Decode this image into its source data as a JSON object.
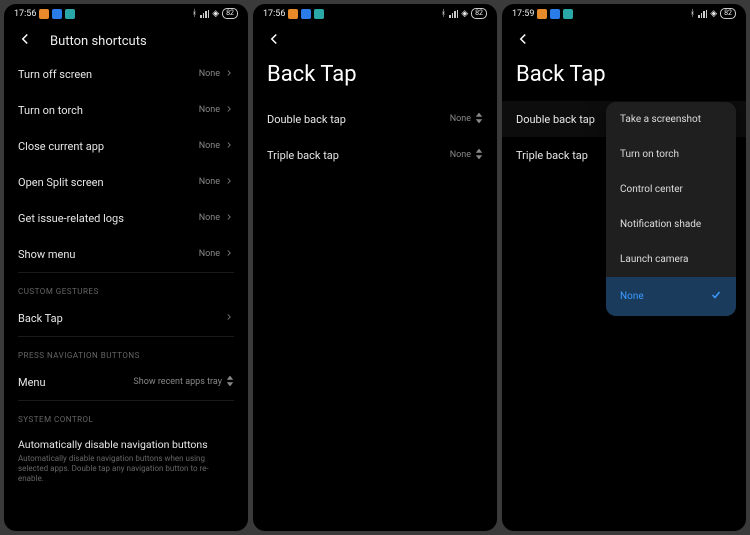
{
  "screen1": {
    "status": {
      "time": "17:56",
      "battery": "82"
    },
    "title": "Button shortcuts",
    "rows": [
      {
        "label": "Turn off screen",
        "value": "None"
      },
      {
        "label": "Turn on torch",
        "value": "None"
      },
      {
        "label": "Close current app",
        "value": "None"
      },
      {
        "label": "Open Split screen",
        "value": "None"
      },
      {
        "label": "Get issue-related logs",
        "value": "None"
      },
      {
        "label": "Show menu",
        "value": "None"
      }
    ],
    "section_custom": "CUSTOM GESTURES",
    "backtap_label": "Back Tap",
    "section_nav": "PRESS NAVIGATION BUTTONS",
    "menu_label": "Menu",
    "menu_value": "Show recent apps tray",
    "section_system": "SYSTEM CONTROL",
    "auto_disable_title": "Automatically disable navigation buttons",
    "auto_disable_sub": "Automatically disable navigation buttons when using selected apps. Double tap any navigation button to re-enable."
  },
  "screen2": {
    "status": {
      "time": "17:56",
      "battery": "82"
    },
    "title": "Back Tap",
    "rows": [
      {
        "label": "Double back tap",
        "value": "None"
      },
      {
        "label": "Triple back tap",
        "value": "None"
      }
    ]
  },
  "screen3": {
    "status": {
      "time": "17:59",
      "battery": "82"
    },
    "title": "Back Tap",
    "rows": [
      {
        "label": "Double back tap"
      },
      {
        "label": "Triple back tap"
      }
    ],
    "popup": [
      "Take a screenshot",
      "Turn on torch",
      "Control center",
      "Notification shade",
      "Launch camera",
      "None"
    ]
  }
}
